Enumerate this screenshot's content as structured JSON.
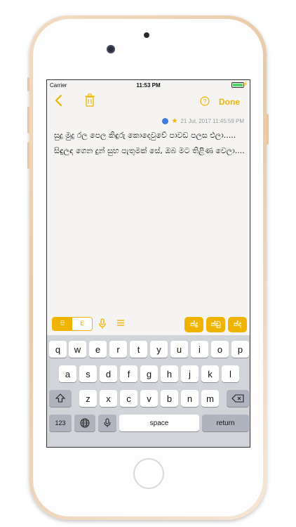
{
  "status": {
    "carrier": "Carrier",
    "time": "11:53 PM"
  },
  "toolbar": {
    "done_label": "Done"
  },
  "note": {
    "timestamp": "21 Jul, 2017 11:45:59 PM",
    "paragraph1": "සුදු මුදු රල පෙල කිඳුරු කොදෙවුවේ පාවඩ පලස එලා.....",
    "paragraph2": "සිඳුලඳ ගෙන දුන් සුභ පැතුමක් සේ, ඔබ මට තිළිණ වෙලා...."
  },
  "input_mode": {
    "sinhala": "සි",
    "english": "E"
  },
  "suggestions": [
    "න්දු",
    "න්ඩු",
    "න්ද"
  ],
  "keyboard": {
    "row1": [
      "q",
      "w",
      "e",
      "r",
      "t",
      "y",
      "u",
      "i",
      "o",
      "p"
    ],
    "row2": [
      "a",
      "s",
      "d",
      "f",
      "g",
      "h",
      "j",
      "k",
      "l"
    ],
    "row3": [
      "z",
      "x",
      "c",
      "v",
      "b",
      "n",
      "m"
    ],
    "numbers_label": "123",
    "space_label": "space",
    "return_label": "return"
  },
  "icons": {
    "back": "chevron-left-icon",
    "trash": "trash-icon",
    "help": "help-icon",
    "flag": "flag-icon",
    "star": "star-icon",
    "mic": "microphone-icon",
    "menu": "menu-icon",
    "shift": "shift-icon",
    "delete": "delete-icon",
    "globe": "globe-icon",
    "dictation": "microphone-icon"
  },
  "colors": {
    "accent": "#f0b400",
    "keyboard_bg": "#d1d4d9",
    "battery": "#4cd964"
  }
}
